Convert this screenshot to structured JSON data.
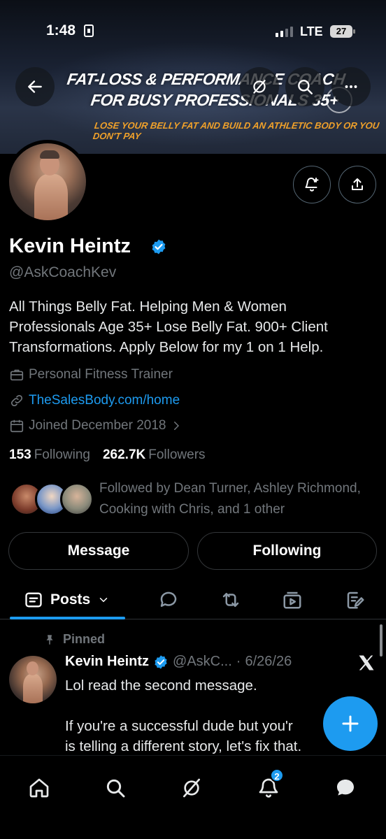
{
  "status_bar": {
    "time": "1:48",
    "network": "LTE",
    "battery": "27"
  },
  "banner": {
    "line1": "FAT-LOSS & PERFORMANCE COACH",
    "line2": "FOR BUSY PROFESSIONALS 35+",
    "line3": "LOSE YOUR BELLY FAT AND BUILD AN ATHLETIC BODY OR YOU DON'T PAY"
  },
  "profile": {
    "name": "Kevin Heintz",
    "handle": "@AskCoachKev",
    "bio": "All Things Belly Fat. Helping Men & Women Professionals Age 35+ Lose Belly Fat. 900+ Client Transformations. Apply Below for my 1 on 1 Help.",
    "category": "Personal Fitness Trainer",
    "website": "TheSalesBody.com/home",
    "joined": "Joined December 2018",
    "following_count": "153",
    "following_label": "Following",
    "followers_count": "262.7K",
    "followers_label": "Followers",
    "followed_by": "Followed by Dean Turner, Ashley Richmond, Cooking with Chris, and 1 other"
  },
  "actions": {
    "message": "Message",
    "following": "Following"
  },
  "tabs": {
    "posts": "Posts"
  },
  "pinned_post": {
    "pinned_label": "Pinned",
    "author": "Kevin Heintz",
    "handle": "@AskC...",
    "separator": "·",
    "date": "6/26/26",
    "text": "Lol read the second message.\n\nIf you're a successful dude but you'r\nis telling a different story, let's fix that."
  },
  "nav": {
    "notifications_badge": "2"
  },
  "colors": {
    "accent": "#1d9bf0",
    "muted": "#71767b",
    "background": "#000000"
  }
}
